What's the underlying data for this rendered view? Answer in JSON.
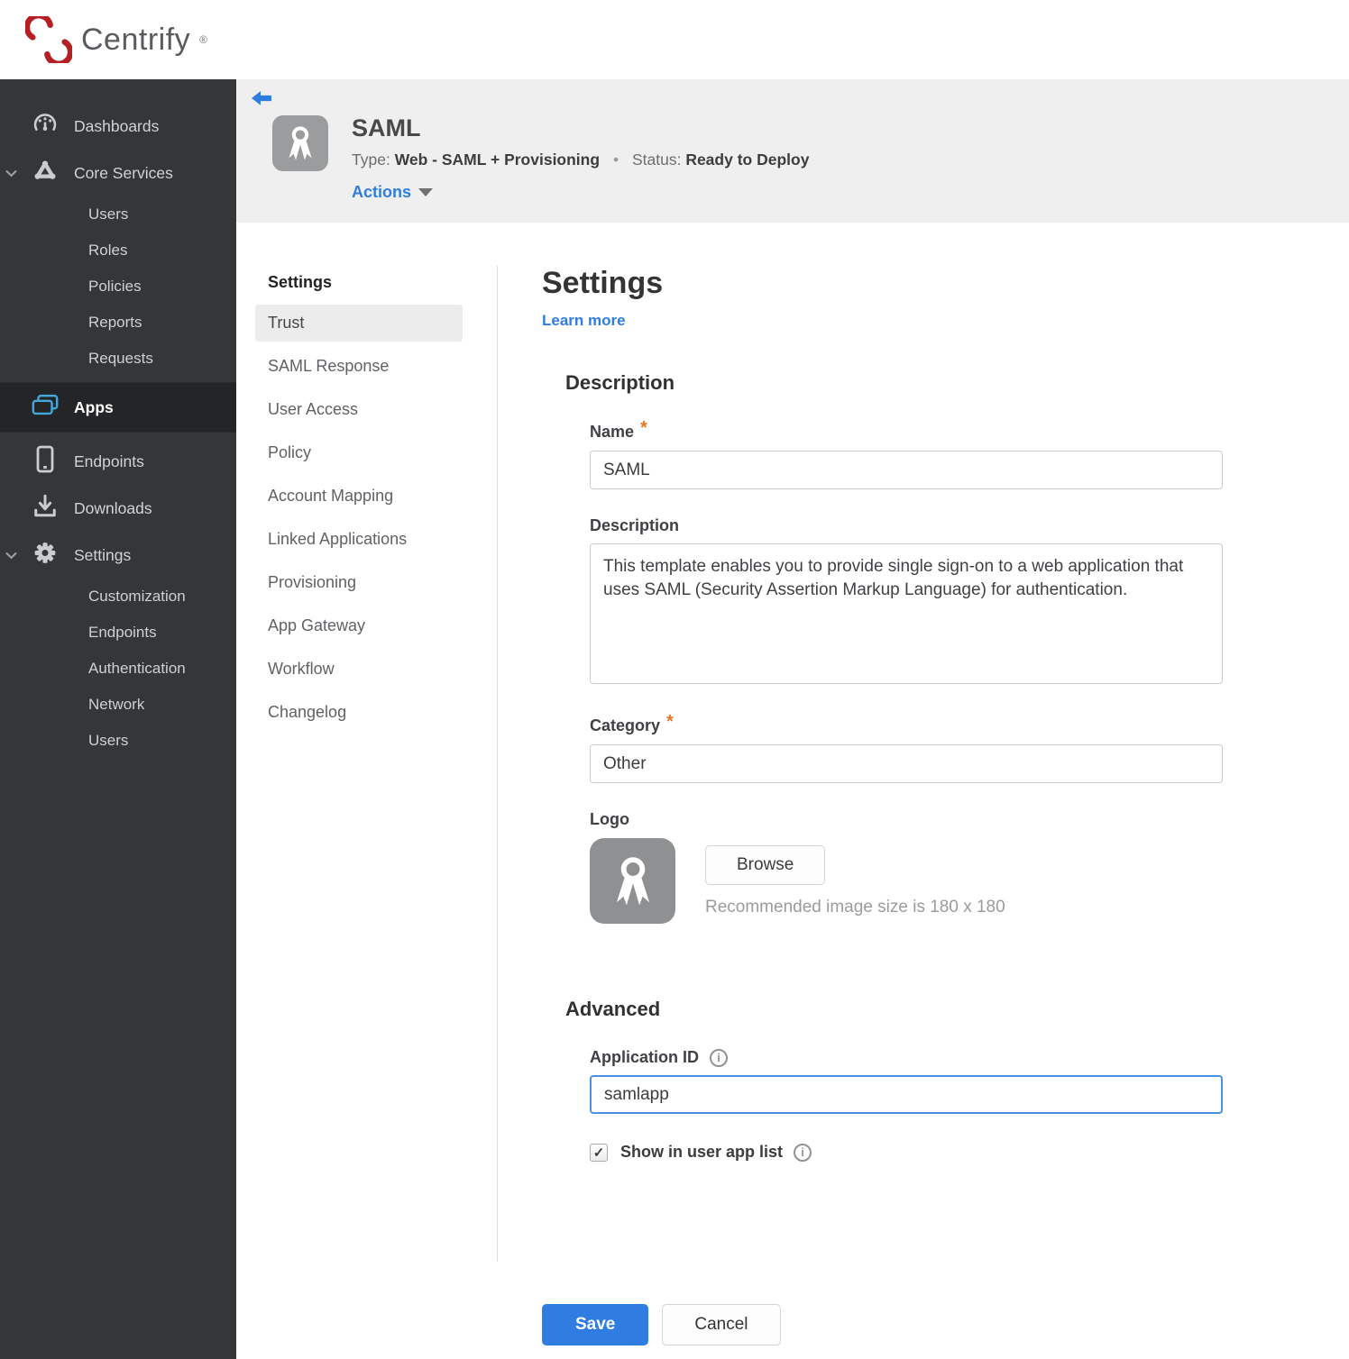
{
  "brand": {
    "name": "Centrify",
    "registered": "®"
  },
  "sidebar": {
    "items": [
      {
        "label": "Dashboards"
      },
      {
        "label": "Core Services",
        "expanded": true,
        "children": [
          "Users",
          "Roles",
          "Policies",
          "Reports",
          "Requests"
        ]
      },
      {
        "label": "Apps",
        "active": true
      },
      {
        "label": "Endpoints"
      },
      {
        "label": "Downloads"
      },
      {
        "label": "Settings",
        "expanded": true,
        "children": [
          "Customization",
          "Endpoints",
          "Authentication",
          "Network",
          "Users"
        ]
      }
    ]
  },
  "app_header": {
    "title": "SAML",
    "type_label": "Type:",
    "type_value": "Web - SAML + Provisioning",
    "status_label": "Status:",
    "status_value": "Ready to Deploy",
    "actions_label": "Actions"
  },
  "subnav": {
    "header": "Settings",
    "items": [
      "Trust",
      "SAML Response",
      "User Access",
      "Policy",
      "Account Mapping",
      "Linked Applications",
      "Provisioning",
      "App Gateway",
      "Workflow",
      "Changelog"
    ],
    "active_item": "Trust"
  },
  "main": {
    "title": "Settings",
    "learn_more": "Learn more",
    "description_section": {
      "heading": "Description",
      "name_label": "Name",
      "name_value": "SAML",
      "description_label": "Description",
      "description_value": "This template enables you to provide single sign-on to a web application that uses SAML (Security Assertion Markup Language) for authentication.",
      "category_label": "Category",
      "category_value": "Other",
      "logo_label": "Logo",
      "browse_label": "Browse",
      "logo_hint": "Recommended image size is 180 x 180"
    },
    "advanced_section": {
      "heading": "Advanced",
      "app_id_label": "Application ID",
      "app_id_value": "samlapp",
      "show_in_list_label": "Show in user app list",
      "checkbox_checked": true
    },
    "footer": {
      "save_label": "Save",
      "cancel_label": "Cancel"
    }
  },
  "misc": {
    "required_marker": "*",
    "checkmark": "✓",
    "info_glyph": "i",
    "dot_separator": "•"
  },
  "colors": {
    "accent_blue": "#2f7de1",
    "status_red": "#a02123",
    "apps_icon_blue": "#45a6d9",
    "brand_red": "#b62025",
    "sidebar_bg": "#343638"
  }
}
